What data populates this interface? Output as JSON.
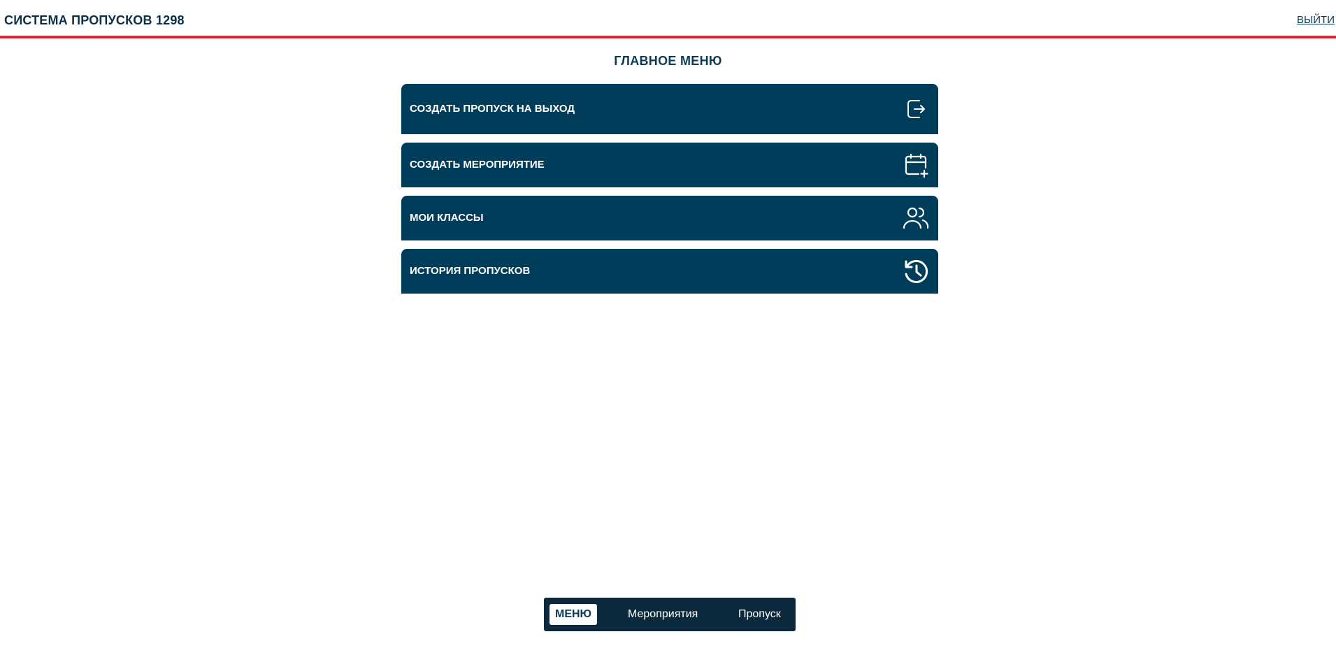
{
  "header": {
    "title": "СИСТЕМА ПРОПУСКОВ 1298",
    "logout_label": "ВЫЙТИ"
  },
  "main": {
    "title": "ГЛАВНОЕ МЕНЮ",
    "items": [
      {
        "label": "СОЗДАТЬ ПРОПУСК НА ВЫХОД",
        "icon": "exit-door-arrow-icon"
      },
      {
        "label": "СОЗДАТЬ МЕРОПРИЯТИЕ",
        "icon": "calendar-add-icon"
      },
      {
        "label": "МОИ КЛАССЫ",
        "icon": "users-icon"
      },
      {
        "label": "ИСТОРИЯ ПРОПУСКОВ",
        "icon": "history-clock-icon"
      }
    ]
  },
  "bottom_nav": {
    "items": [
      {
        "label": "МЕНЮ",
        "active": true
      },
      {
        "label": "Мероприятия",
        "active": false
      },
      {
        "label": "Пропуск",
        "active": false
      }
    ]
  },
  "colors": {
    "accent_red": "#e3242b",
    "primary": "#003d5b",
    "nav_bg": "#0b2a3e"
  }
}
